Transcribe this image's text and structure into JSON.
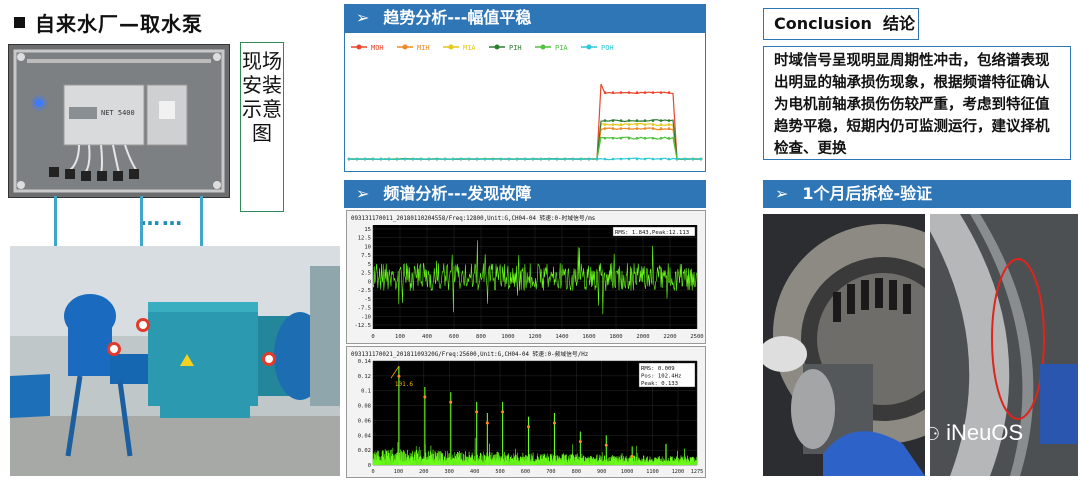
{
  "left": {
    "title": "自来水厂—取水泵",
    "vertical_label": "现场安装示意图",
    "ellipsis": "……",
    "device_label": "NET 5400"
  },
  "trend": {
    "heading": "趋势分析---幅值平稳",
    "chart_data": {
      "type": "line",
      "legend_position": "top-left",
      "series": [
        {
          "name": "MOH",
          "color": "#e8452c",
          "baseline": 0,
          "plateau": 0.83
        },
        {
          "name": "MIH",
          "color": "#f08a24",
          "baseline": 0,
          "plateau": 0.38
        },
        {
          "name": "MIA",
          "color": "#e6c619",
          "baseline": 0,
          "plateau": 0.43
        },
        {
          "name": "PIH",
          "color": "#2e7d32",
          "baseline": 0,
          "plateau": 0.48
        },
        {
          "name": "PIA",
          "color": "#4cc43c",
          "baseline": 0,
          "plateau": 0.26
        },
        {
          "name": "POH",
          "color": "#2cc9d6",
          "baseline": 0,
          "plateau": 0.0
        }
      ],
      "plateau_range": [
        0.71,
        0.93
      ],
      "grid": false
    }
  },
  "spectrum": {
    "heading": "频谱分析---发现故障",
    "time_chart": {
      "type": "line",
      "header": "093131170011_20180110204558/Freq:12800,Unit:G,CH04-04 转速:0-时域信号/ms",
      "stats": "RMS: 1.843,Peak:12.113",
      "y_ticks": [
        "15",
        "12.5",
        "10",
        "7.5",
        "5",
        "2.5",
        "0",
        "-2.5",
        "-5",
        "-7.5",
        "-10",
        "-12.5"
      ],
      "x_ticks": [
        "0",
        "100",
        "400",
        "600",
        "800",
        "1000",
        "1200",
        "1400",
        "1600",
        "1800",
        "2000",
        "2200",
        "2500"
      ],
      "color": "#6bff1a"
    },
    "freq_chart": {
      "type": "line",
      "header": "093131170021_20181109320G/Freq:25600,Unit:G,CH04-04 转速:0-频域信号/Hz",
      "stats": [
        "RMS: 0.009",
        "Pos: 102.4Hz",
        "Peak: 0.133"
      ],
      "annotation": "101.6",
      "y_ticks": [
        "0.14",
        "0.12",
        "0.1",
        "0.08",
        "0.06",
        "0.04",
        "0.02",
        "0"
      ],
      "x_ticks": [
        "0",
        "100",
        "200",
        "300",
        "400",
        "500",
        "600",
        "700",
        "800",
        "900",
        "1000",
        "1100",
        "1200",
        "1275"
      ],
      "peaks": [
        {
          "x": 102,
          "y": 0.133
        },
        {
          "x": 204,
          "y": 0.105
        },
        {
          "x": 306,
          "y": 0.098
        },
        {
          "x": 408,
          "y": 0.085
        },
        {
          "x": 450,
          "y": 0.07
        },
        {
          "x": 510,
          "y": 0.085
        },
        {
          "x": 612,
          "y": 0.065
        },
        {
          "x": 714,
          "y": 0.07
        },
        {
          "x": 816,
          "y": 0.045
        },
        {
          "x": 918,
          "y": 0.04
        },
        {
          "x": 1020,
          "y": 0.025
        }
      ],
      "color": "#6bff1a"
    }
  },
  "conclusion": {
    "label_en": "Conclusion",
    "label_cn": "结论",
    "text": "时域信号呈现明显周期性冲击，包络谱表现出明显的轴承损伤现象，根据频谱特征确认为电机前轴承损伤伤较严重，考虑到特征值趋势平稳，短期内仍可监测运行，建议择机检查、更换"
  },
  "verify": {
    "heading": "1个月后拆检-验证"
  },
  "watermark": "iNeuOS"
}
